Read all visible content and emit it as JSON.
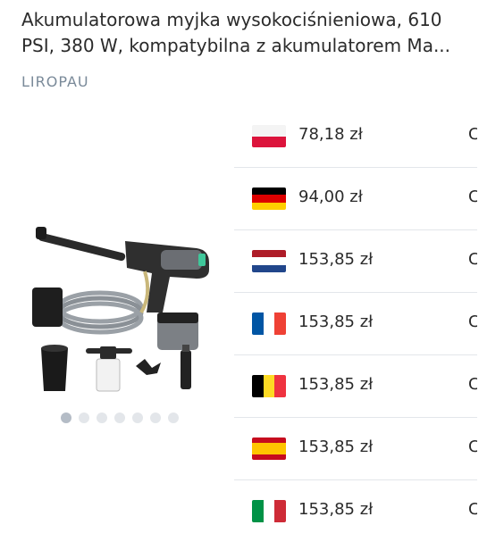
{
  "product": {
    "title": "Akumulatorowa myjka wysokociśnieniowa, 610 PSI, 380 W, kompatybilna z akumulatorem Ma...",
    "brand": "LIROPAU",
    "image_icon": "pressure-washer-kit-image",
    "carousel": {
      "total": 7,
      "active_index": 0
    }
  },
  "offers": [
    {
      "country": "Poland",
      "flag_icon": "flag-pl-icon",
      "price": "78,18 zł",
      "more": "C"
    },
    {
      "country": "Germany",
      "flag_icon": "flag-de-icon",
      "price": "94,00 zł",
      "more": "C"
    },
    {
      "country": "Netherlands",
      "flag_icon": "flag-nl-icon",
      "price": "153,85 zł",
      "more": "C"
    },
    {
      "country": "France",
      "flag_icon": "flag-fr-icon",
      "price": "153,85 zł",
      "more": "C"
    },
    {
      "country": "Belgium",
      "flag_icon": "flag-be-icon",
      "price": "153,85 zł",
      "more": "C"
    },
    {
      "country": "Spain",
      "flag_icon": "flag-es-icon",
      "price": "153,85 zł",
      "more": "C"
    },
    {
      "country": "Italy",
      "flag_icon": "flag-it-icon",
      "price": "153,85 zł",
      "more": "C"
    }
  ]
}
